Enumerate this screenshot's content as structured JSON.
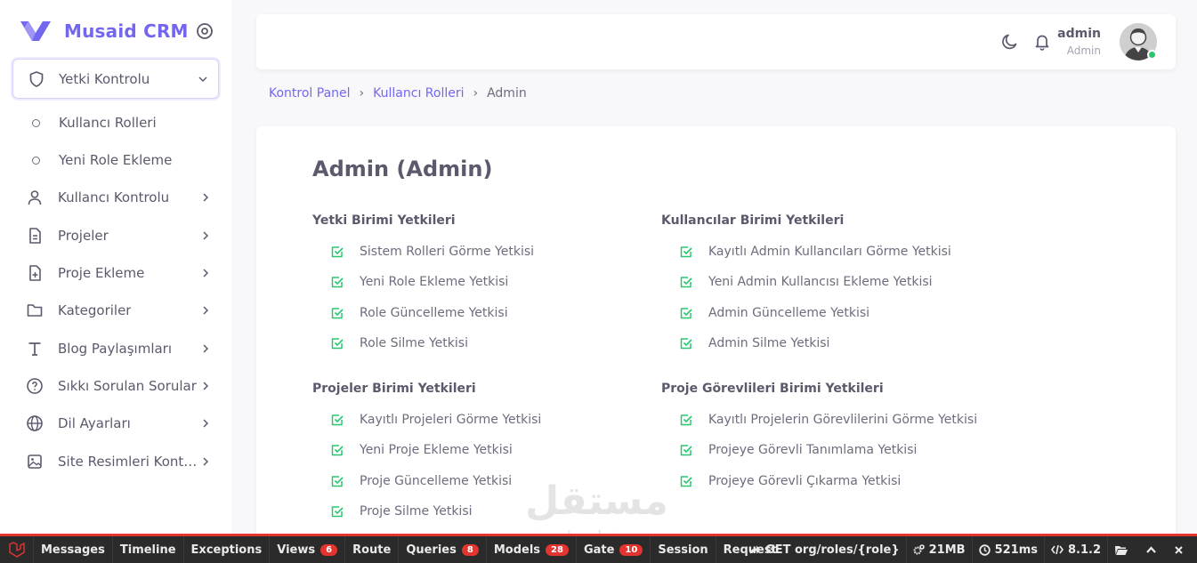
{
  "brand": {
    "name": "Musaid CRM"
  },
  "sidebar": {
    "active_menu": "Yetki Kontrolu",
    "sub_items": [
      {
        "label": "Kullancı Rolleri"
      },
      {
        "label": "Yeni Role Ekleme"
      }
    ],
    "items": [
      {
        "label": "Kullancı Kontrolu",
        "icon": "user-icon"
      },
      {
        "label": "Projeler",
        "icon": "file-text-icon"
      },
      {
        "label": "Proje Ekleme",
        "icon": "file-plus-icon"
      },
      {
        "label": "Kategoriler",
        "icon": "folder-icon"
      },
      {
        "label": "Blog Paylaşımları",
        "icon": "type-icon"
      },
      {
        "label": "Sıkkı Sorulan Sorular",
        "icon": "help-circle-icon"
      },
      {
        "label": "Dil Ayarları",
        "icon": "globe-icon"
      },
      {
        "label": "Site Resimleri Kontrolu",
        "icon": "image-icon"
      }
    ]
  },
  "topbar": {
    "user_name": "admin",
    "user_role": "Admin"
  },
  "breadcrumb": {
    "items": [
      "Kontrol Panel",
      "Kullancı Rolleri"
    ],
    "current": "Admin"
  },
  "card": {
    "title": "Admin (Admin)",
    "groups": [
      {
        "title": "Yetki Birimi Yetkileri",
        "permissions": [
          "Sistem Rolleri Görme Yetkisi",
          "Yeni Role Ekleme Yetkisi",
          "Role Güncelleme Yetkisi",
          "Role Silme Yetkisi"
        ]
      },
      {
        "title": "Kullancılar Birimi Yetkileri",
        "permissions": [
          "Kayıtlı Admin Kullancıları Görme Yetkisi",
          "Yeni Admin Kullancısı Ekleme Yetkisi",
          "Admin Güncelleme Yetkisi",
          "Admin Silme Yetkisi"
        ]
      },
      {
        "title": "Projeler Birimi Yetkileri",
        "permissions": [
          "Kayıtlı Projeleri Görme Yetkisi",
          "Yeni Proje Ekleme Yetkisi",
          "Proje Güncelleme Yetkisi",
          "Proje Silme Yetkisi"
        ]
      },
      {
        "title": "Proje Görevlileri Birimi Yetkileri",
        "permissions": [
          "Kayıtlı Projelerin Görevlilerini Görme Yetkisi",
          "Projeye Görevli Tanımlama Yetkisi",
          "Projeye Görevli Çıkarma Yetkisi"
        ]
      }
    ]
  },
  "watermark": {
    "arabic": "مستقل",
    "latin": "mostaql.com"
  },
  "debugbar": {
    "tabs": [
      {
        "label": "Messages",
        "badge": ""
      },
      {
        "label": "Timeline",
        "badge": ""
      },
      {
        "label": "Exceptions",
        "badge": ""
      },
      {
        "label": "Views",
        "badge": "6"
      },
      {
        "label": "Route",
        "badge": ""
      },
      {
        "label": "Queries",
        "badge": "8"
      },
      {
        "label": "Models",
        "badge": "28"
      },
      {
        "label": "Gate",
        "badge": "10"
      },
      {
        "label": "Session",
        "badge": ""
      },
      {
        "label": "Request",
        "badge": ""
      }
    ],
    "route": "GET org/roles/{role}",
    "memory": "21MB",
    "time": "521ms",
    "php": "8.1.2"
  },
  "colors": {
    "primary": "#7367f0",
    "success": "#28c76f",
    "danger": "#e3342f"
  }
}
